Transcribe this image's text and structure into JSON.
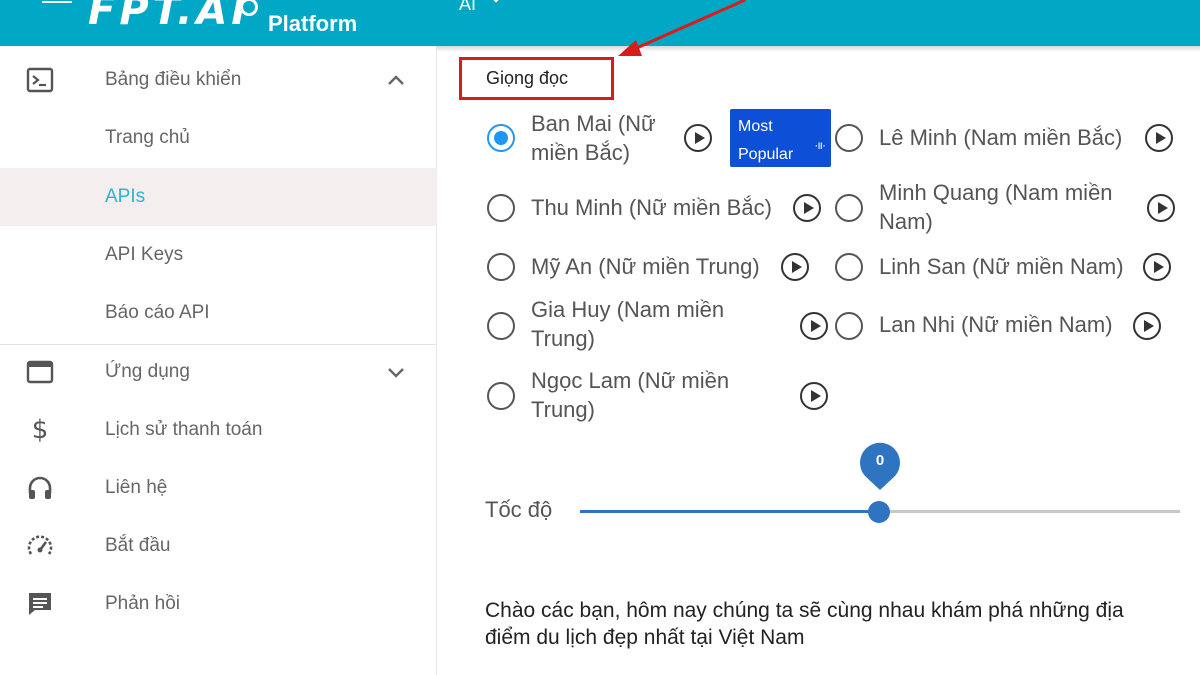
{
  "sidebar": {
    "logo": "FPT.AI",
    "platform_label": "Platform",
    "items": [
      {
        "label": "Bảng điều khiển",
        "icon": "terminal-icon"
      },
      {
        "label": "Trang chủ"
      },
      {
        "label": "APIs",
        "active": true
      },
      {
        "label": "API Keys"
      },
      {
        "label": "Báo cáo API"
      },
      {
        "label": "Ứng dụng",
        "icon": "window-icon"
      },
      {
        "label": "Lịch sử thanh toán",
        "icon": "dollar-icon"
      },
      {
        "label": "Liên hệ",
        "icon": "headphones-icon"
      },
      {
        "label": "Bắt đầu",
        "icon": "speedometer-icon"
      },
      {
        "label": "Phản hồi",
        "icon": "message-icon"
      }
    ]
  },
  "topbar": {
    "label": "AI"
  },
  "voice_section": {
    "title": "Giọng đọc",
    "voices": [
      {
        "name": "Ban Mai (Nữ miền Bắc)",
        "line1": "Ban Mai (Nữ",
        "line2": "miền Bắc)",
        "selected": true
      },
      {
        "name": "Lê Minh (Nam miền Bắc)"
      },
      {
        "name": "Thu Minh (Nữ miền Bắc)"
      },
      {
        "name": "Minh Quang (Nam miền Nam)",
        "line1": "Minh Quang (Nam miền",
        "line2": "Nam)"
      },
      {
        "name": "Mỹ An (Nữ miền Trung)"
      },
      {
        "name": "Linh San (Nữ miền Nam)"
      },
      {
        "name": "Gia Huy (Nam miền Trung)",
        "line1": "Gia Huy (Nam miền",
        "line2": "Trung)"
      },
      {
        "name": "Lan Nhi (Nữ miền Nam)"
      },
      {
        "name": "Ngọc Lam (Nữ miền Trung)",
        "line1": "Ngọc Lam (Nữ miền",
        "line2": "Trung)"
      }
    ],
    "badge": {
      "line1": "Most",
      "line2": "Popular",
      "wave_glyph": "·ıı·"
    }
  },
  "speed": {
    "label": "Tốc độ",
    "value": "0",
    "min": -3,
    "max": 3,
    "current": 0
  },
  "sample_text": "Chào các bạn, hôm nay chúng ta sẽ cùng nhau khám phá những địa điểm du lịch đẹp nhất tại Việt Nam",
  "colors": {
    "accent": "#00a8c6",
    "primary": "#2196f3",
    "highlight": "#d81c1c",
    "badge": "#0d4fd6"
  }
}
